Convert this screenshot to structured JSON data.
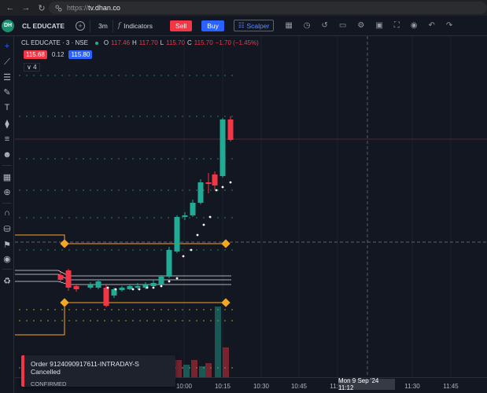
{
  "browser": {
    "url_protocol": "https://",
    "url_host": "tv.dhan.co"
  },
  "toolbar": {
    "logo": "DH",
    "symbol": "CL EDUCATE",
    "interval": "3m",
    "indicators_label": "Indicators",
    "sell_label": "Sell",
    "buy_label": "Buy",
    "scalper_label": "Scalper"
  },
  "legend": {
    "title": "CL EDUCATE · 3 · NSE",
    "o_key": "O",
    "o_val": "117.46",
    "h_key": "H",
    "h_val": "117.70",
    "l_key": "L",
    "l_val": "115.70",
    "c_key": "C",
    "c_val": "115.70",
    "change": "−1.70 (−1.45%)",
    "bid": "115.68",
    "spread": "0.12",
    "ask": "115.80",
    "collapse_label": "4"
  },
  "time_axis": {
    "ticks": [
      "10:00",
      "10:15",
      "10:30",
      "10:45",
      "11:00",
      "11:30",
      "11:45"
    ],
    "crosshair_label": "Mon 9 Sep '24   11:12"
  },
  "toast": {
    "title": "Order 9124090917611-INTRADAY-S Cancelled",
    "status": "CONFIRMED"
  },
  "colors": {
    "up": "#22ab94",
    "down": "#f23645",
    "accent": "#2962ff",
    "level": "#f5a623"
  },
  "icons": [
    "crosshair-icon",
    "trendline-icon",
    "fib-icon",
    "brush-icon",
    "text-icon",
    "pattern-icon",
    "forecast-icon",
    "ruler-icon",
    "zoom-icon",
    "magnet-icon",
    "lock-icon",
    "eye-icon",
    "trash-icon"
  ]
}
